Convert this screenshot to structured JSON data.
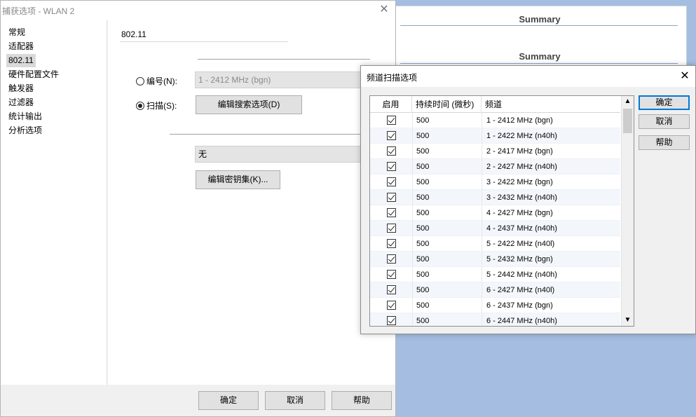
{
  "background_window": {
    "summary_1": "Summary",
    "summary_2": "Summary"
  },
  "main_dialog": {
    "title": "捕获选项 - WLAN 2",
    "nav": [
      "常规",
      "适配器",
      "802.11",
      "硬件配置文件",
      "触发器",
      "过滤器",
      "统计输出",
      "分析选项"
    ],
    "selected_nav": "802.11",
    "section_title": "802.11",
    "number_label": "编号(N):",
    "number_value": "1 - 2412 MHz (bgn)",
    "scan_label": "扫描(S):",
    "edit_search_button": "编辑搜索选项(D)",
    "key_value": "无",
    "edit_keyset_button": "编辑密钥集(K)...",
    "ok_button": "确定",
    "cancel_button": "取消",
    "help_button": "帮助"
  },
  "scan_dialog": {
    "title": "频道扫描选项",
    "columns": {
      "enabled": "启用",
      "duration": "持续时间 (微秒)",
      "channel": "频道"
    },
    "rows": [
      {
        "enabled": true,
        "duration": "500",
        "channel": "1 - 2412 MHz (bgn)"
      },
      {
        "enabled": true,
        "duration": "500",
        "channel": "1 - 2422 MHz (n40h)"
      },
      {
        "enabled": true,
        "duration": "500",
        "channel": "2 - 2417 MHz (bgn)"
      },
      {
        "enabled": true,
        "duration": "500",
        "channel": "2 - 2427 MHz (n40h)"
      },
      {
        "enabled": true,
        "duration": "500",
        "channel": "3 - 2422 MHz (bgn)"
      },
      {
        "enabled": true,
        "duration": "500",
        "channel": "3 - 2432 MHz (n40h)"
      },
      {
        "enabled": true,
        "duration": "500",
        "channel": "4 - 2427 MHz (bgn)"
      },
      {
        "enabled": true,
        "duration": "500",
        "channel": "4 - 2437 MHz (n40h)"
      },
      {
        "enabled": true,
        "duration": "500",
        "channel": "5 - 2422 MHz (n40l)"
      },
      {
        "enabled": true,
        "duration": "500",
        "channel": "5 - 2432 MHz (bgn)"
      },
      {
        "enabled": true,
        "duration": "500",
        "channel": "5 - 2442 MHz (n40h)"
      },
      {
        "enabled": true,
        "duration": "500",
        "channel": "6 - 2427 MHz (n40l)"
      },
      {
        "enabled": true,
        "duration": "500",
        "channel": "6 - 2437 MHz (bgn)"
      },
      {
        "enabled": true,
        "duration": "500",
        "channel": "6 - 2447 MHz (n40h)"
      }
    ],
    "ok_button": "确定",
    "cancel_button": "取消",
    "help_button": "帮助"
  },
  "icons": {
    "close": "close-icon",
    "scroll_up": "chevron-up-icon",
    "scroll_down": "chevron-down-icon",
    "checkbox": "checkbox-checked-icon"
  },
  "colors": {
    "desktop": "#a4bde0",
    "default_button_border": "#0078d7"
  }
}
